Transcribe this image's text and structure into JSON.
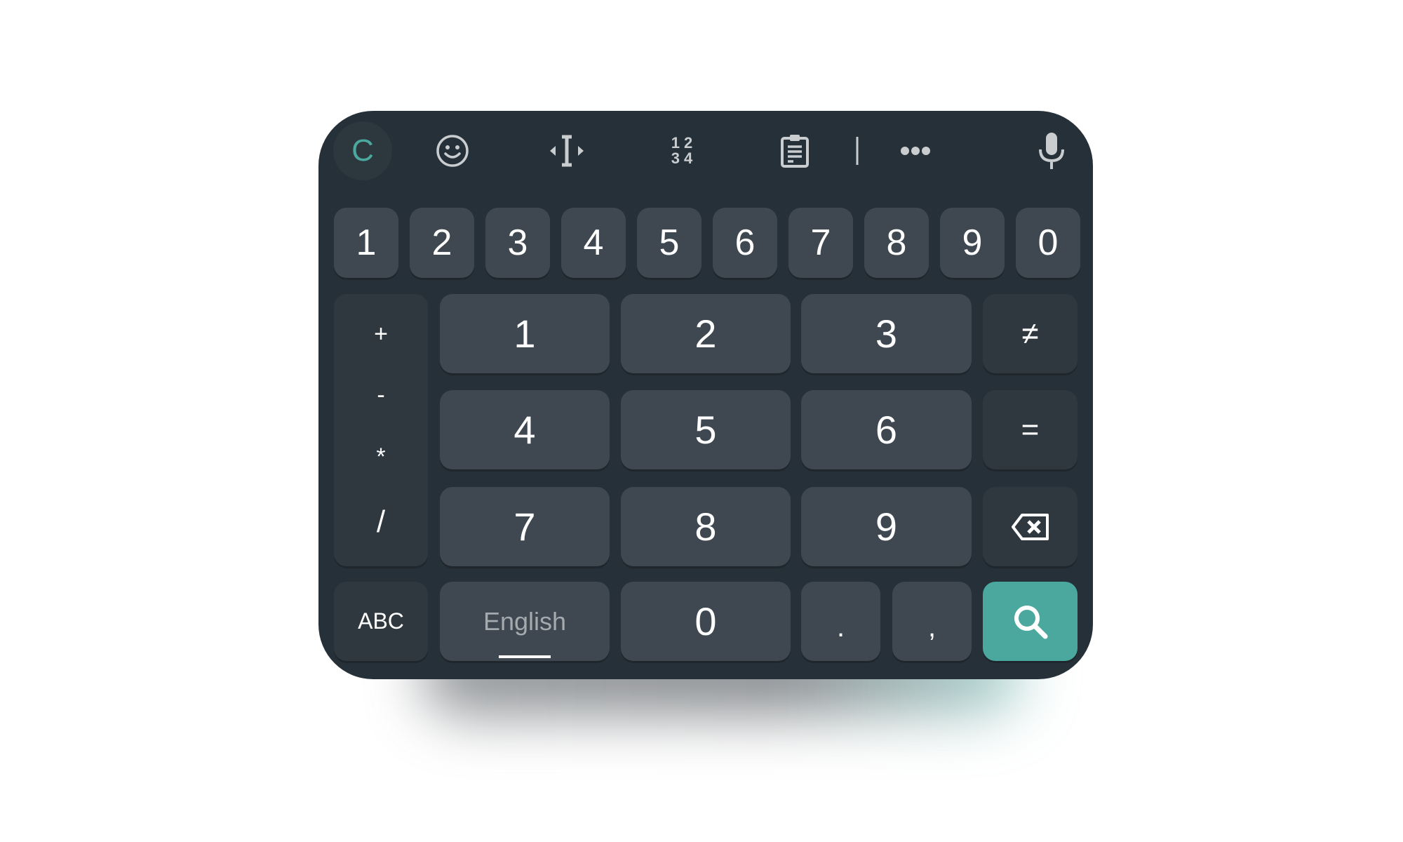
{
  "toolbar": {
    "icons": [
      "clear-c-icon",
      "emoji-icon",
      "cursor-move-icon",
      "number-pad-icon",
      "clipboard-icon",
      "divider",
      "more-icon",
      "microphone-icon"
    ],
    "c_label": "C",
    "numpad_label": [
      "1 2",
      "3 4"
    ]
  },
  "number_row": [
    "1",
    "2",
    "3",
    "4",
    "5",
    "6",
    "7",
    "8",
    "9",
    "0"
  ],
  "operators": [
    "+",
    "-",
    "*",
    "/"
  ],
  "numpad": {
    "k1": "1",
    "k2": "2",
    "k3": "3",
    "k4": "4",
    "k5": "5",
    "k6": "6",
    "k7": "7",
    "k8": "8",
    "k9": "9",
    "k0": "0",
    "dot": ".",
    "comma": ","
  },
  "symbols": {
    "not_equal": "≠",
    "equal": "="
  },
  "bottom": {
    "abc": "ABC",
    "language": "English"
  },
  "colors": {
    "keyboard_bg": "#263038",
    "key": "#3f4850",
    "function_key": "#2f383f",
    "accent": "#4aa89e"
  }
}
